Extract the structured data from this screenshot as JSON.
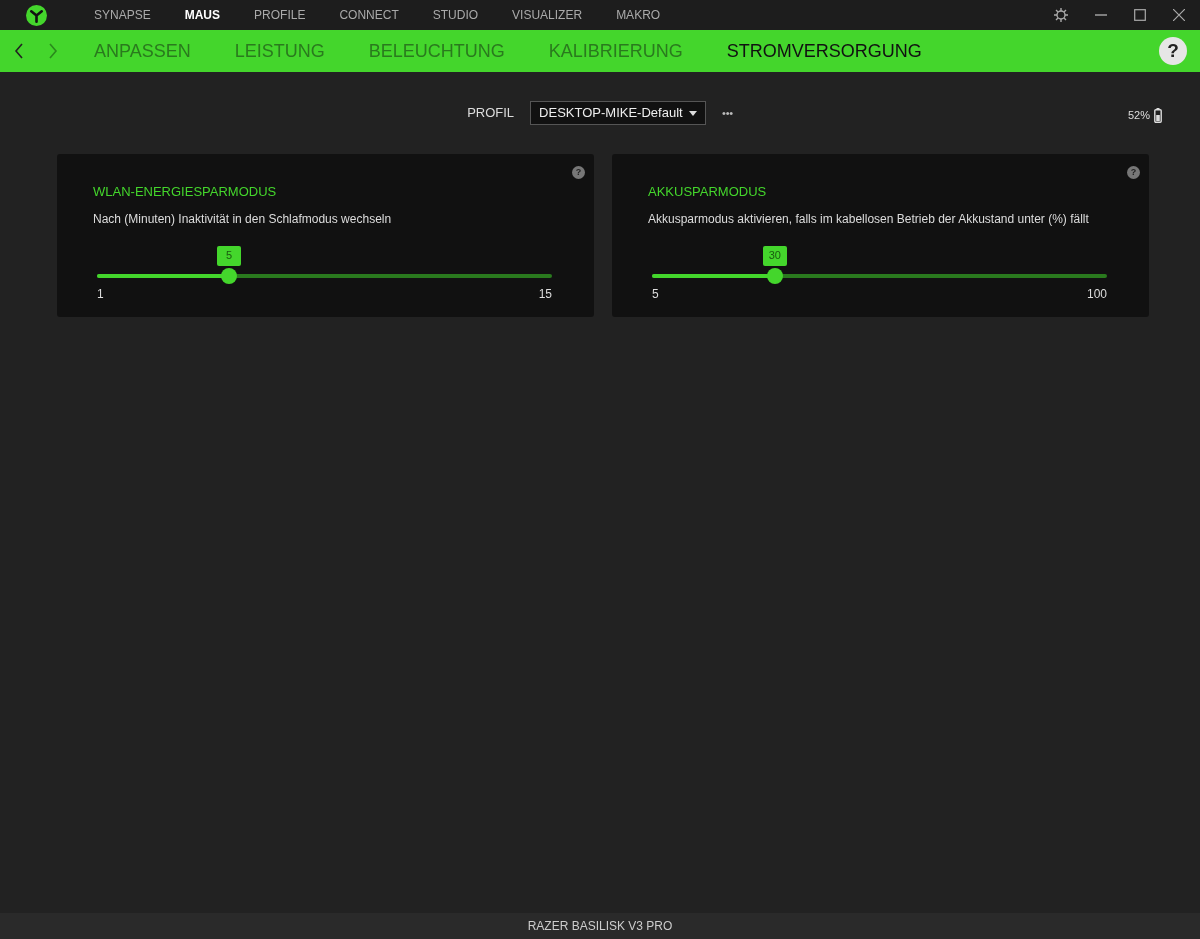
{
  "top_tabs": [
    {
      "label": "SYNAPSE",
      "selected": false
    },
    {
      "label": "MAUS",
      "selected": true
    },
    {
      "label": "PROFILE",
      "selected": false
    },
    {
      "label": "CONNECT",
      "selected": false
    },
    {
      "label": "STUDIO",
      "selected": false
    },
    {
      "label": "VISUALIZER",
      "selected": false
    },
    {
      "label": "MAKRO",
      "selected": false
    }
  ],
  "sub_tabs": [
    {
      "label": "ANPASSEN",
      "selected": false
    },
    {
      "label": "LEISTUNG",
      "selected": false
    },
    {
      "label": "BELEUCHTUNG",
      "selected": false
    },
    {
      "label": "KALIBRIERUNG",
      "selected": false
    },
    {
      "label": "STROMVERSORGUNG",
      "selected": true
    }
  ],
  "profile": {
    "label": "PROFIL",
    "value": "DESKTOP-MIKE-Default",
    "more": "•••"
  },
  "battery": {
    "reading": "52%"
  },
  "help": "?",
  "cards": [
    {
      "title": "WLAN-ENERGIESPARMODUS",
      "description": "Nach (Minuten) Inaktivität in den Schlafmodus wechseln",
      "help": "?",
      "value": "5",
      "level": 0.29,
      "min": "1",
      "max": "15"
    },
    {
      "title": "AKKUSPARMODUS",
      "description": "Akkusparmodus aktivieren, falls im kabellosen Betrieb der Akkustand unter (%) fällt",
      "help": "?",
      "value": "30",
      "level": 0.27,
      "min": "5",
      "max": "100"
    }
  ],
  "status_bar": {
    "device": "RAZER BASILISK V3 PRO"
  }
}
